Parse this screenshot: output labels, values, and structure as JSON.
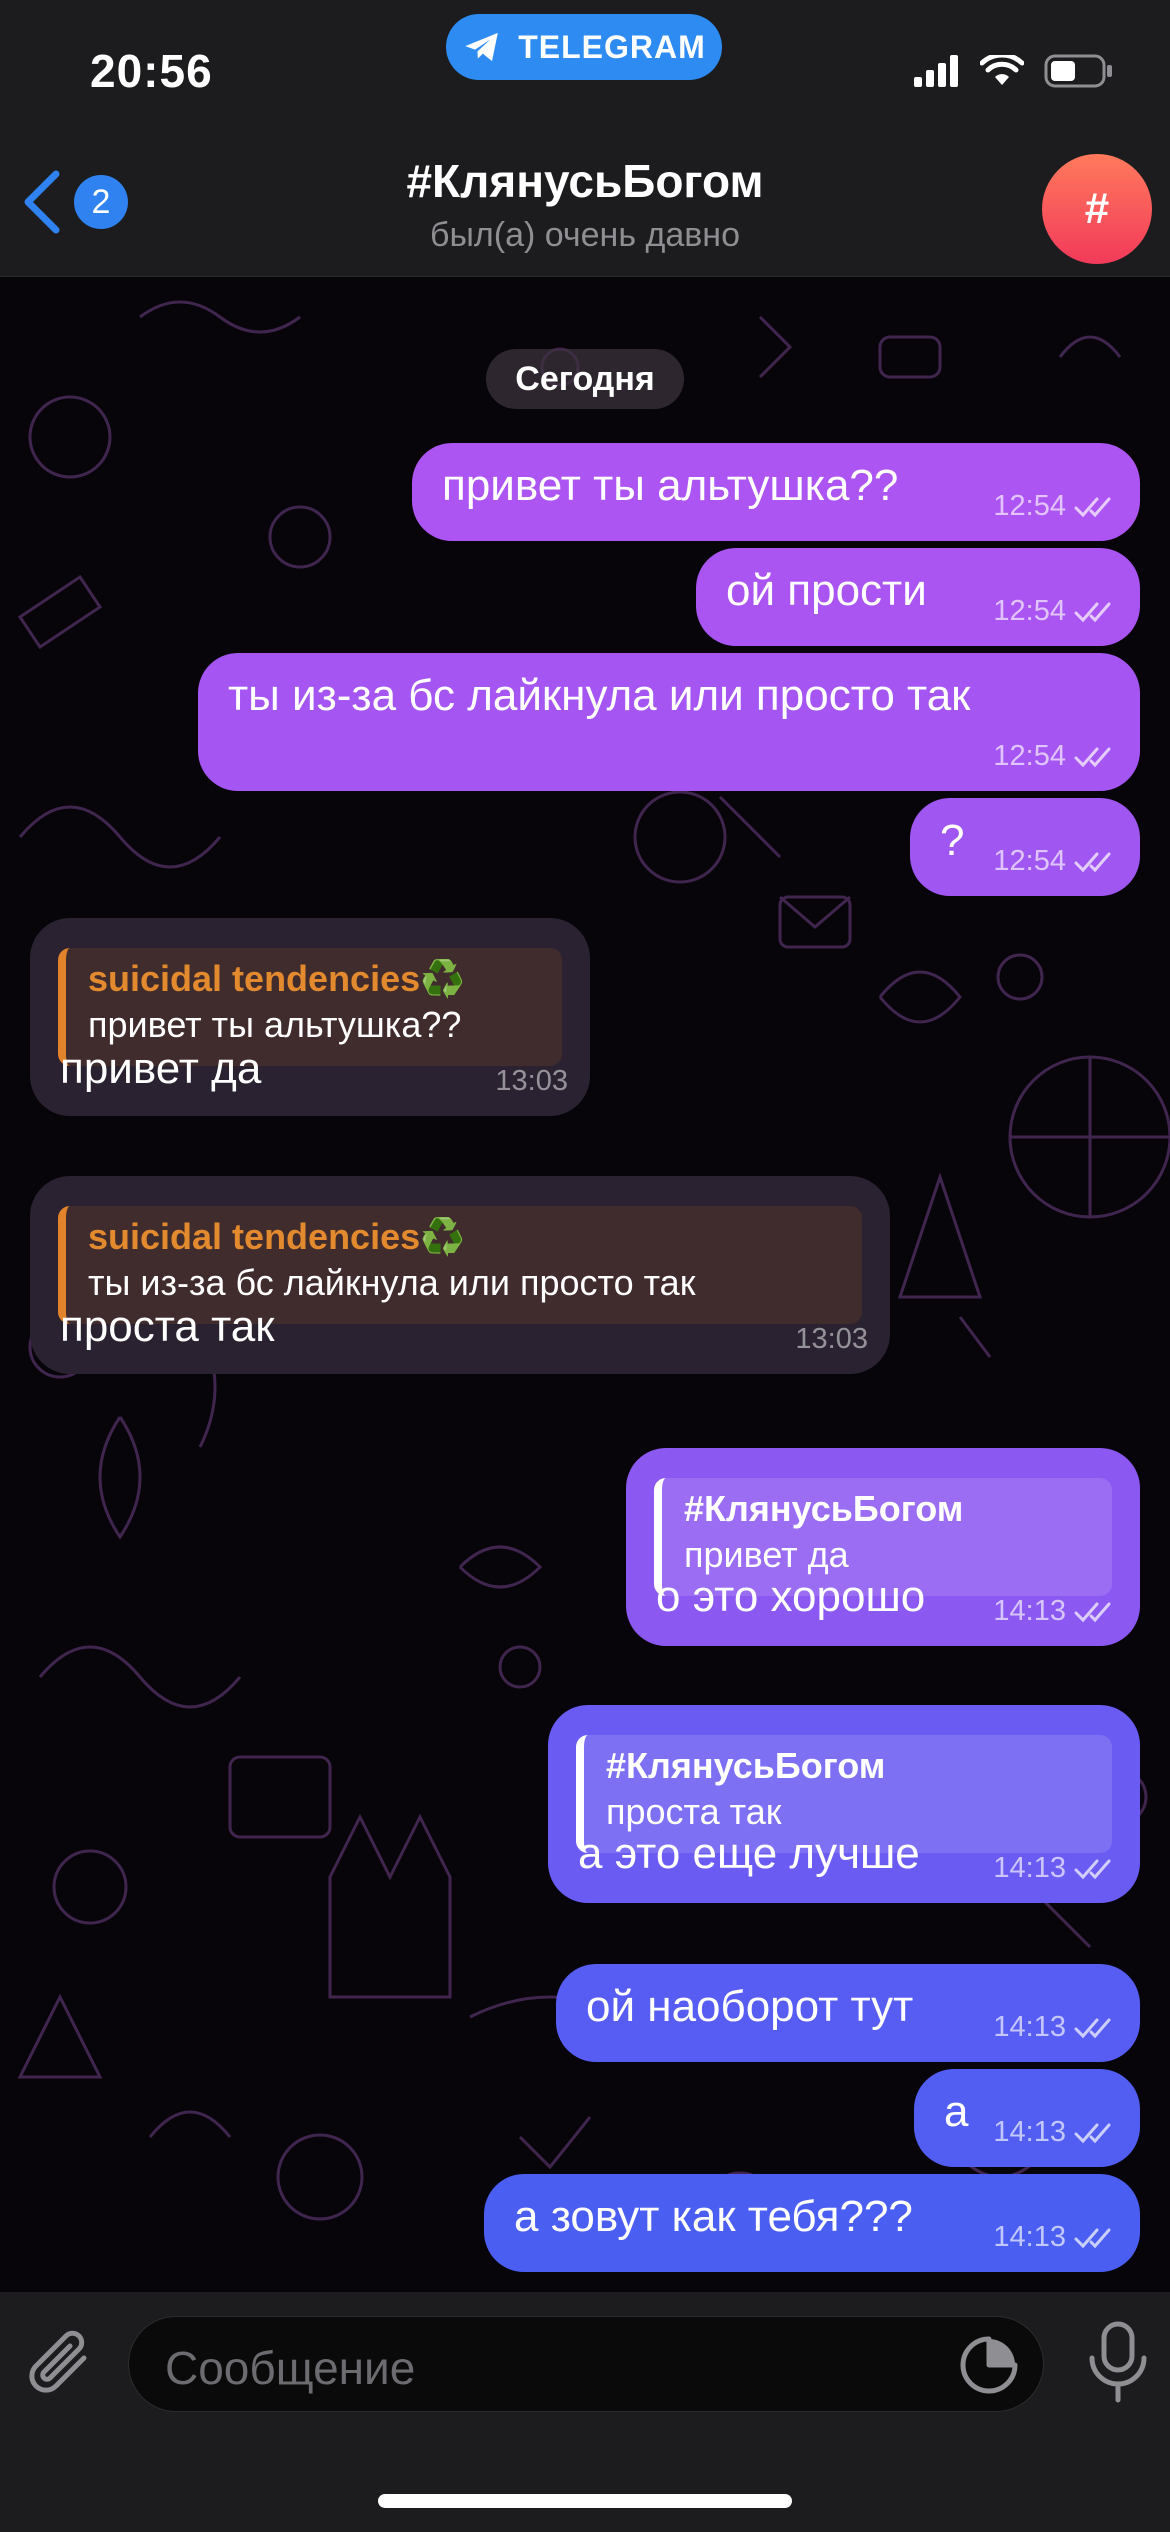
{
  "status_bar": {
    "time": "20:56",
    "app_pill": "TELEGRAM"
  },
  "header": {
    "back_count": "2",
    "title": "#КлянусьБогом",
    "subtitle": "был(а) очень давно",
    "avatar_symbol": "#"
  },
  "chat": {
    "date_label": "Сегодня",
    "messages": [
      {
        "direction": "out",
        "text": "привет ты альтушка??",
        "time": "12:54"
      },
      {
        "direction": "out",
        "text": "ой прости",
        "time": "12:54"
      },
      {
        "direction": "out",
        "text": "ты из-за бс лайкнула или просто так",
        "time": "12:54"
      },
      {
        "direction": "out",
        "text": "?",
        "time": "12:54"
      },
      {
        "direction": "in",
        "reply_author": "suicidal tendencies♻️",
        "reply_text": "привет ты альтушка??",
        "text": "привет да",
        "time": "13:03"
      },
      {
        "direction": "in",
        "reply_author": "suicidal tendencies♻️",
        "reply_text": "ты из-за бс лайкнула или просто так",
        "text": "проста так",
        "time": "13:03"
      },
      {
        "direction": "out",
        "reply_author": "#КлянусьБогом",
        "reply_text": "привет да",
        "text": "о это хорошо",
        "time": "14:13"
      },
      {
        "direction": "out",
        "reply_author": "#КлянусьБогом",
        "reply_text": "проста так",
        "text": "а это еще лучше",
        "time": "14:13"
      },
      {
        "direction": "out",
        "text": "ой наоборот тут",
        "time": "14:13"
      },
      {
        "direction": "out",
        "text": "а",
        "time": "14:13"
      },
      {
        "direction": "out",
        "text": "а зовут как тебя???",
        "time": "14:13"
      }
    ]
  },
  "input": {
    "placeholder": "Сообщение"
  },
  "colors": {
    "header_bg": "#1c1c1e",
    "accent_blue": "#2f82f0",
    "outgoing_top": "#a651f0",
    "outgoing_bottom": "#4a5cf0",
    "incoming_bg": "#2a2230",
    "reply_orange": "#e48a2e"
  }
}
